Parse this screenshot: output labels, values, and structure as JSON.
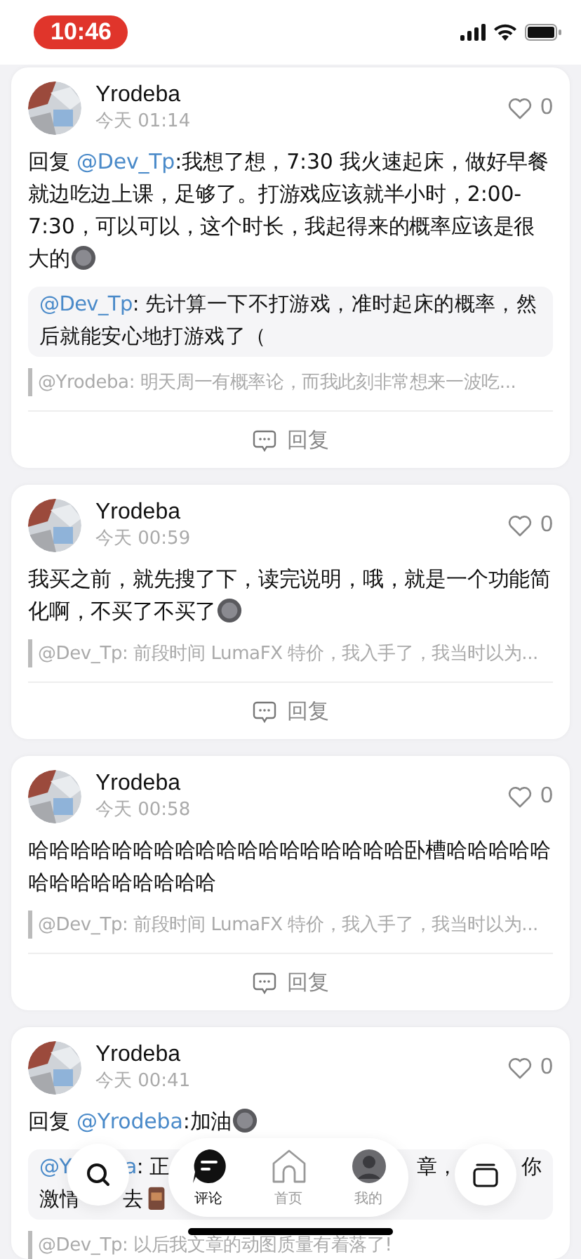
{
  "status_bar": {
    "time": "10:46"
  },
  "comments": [
    {
      "name": "Yrodeba",
      "time": "今天 01:14",
      "likes": "0",
      "liked": false,
      "body": [
        {
          "kind": "text",
          "text": "回复 "
        },
        {
          "kind": "mention",
          "text": "@Dev_Tp"
        },
        {
          "kind": "text",
          "text": ":我想了想，7:30 我火速起床，做好早餐就边吃边上课，足够了。打游戏应该就半小时，2:00-7:30，可以可以，这个时长，我起得来的概率应该是很大的"
        },
        {
          "kind": "sticker"
        }
      ],
      "quote": {
        "lines": [
          [
            [
              {
                "kind": "mention",
                "text": "@Dev_Tp"
              },
              {
                "kind": "text",
                "text": ": 先计算一下不打游戏，准时起床的概率，然"
              }
            ]
          ],
          [
            [
              {
                "kind": "text",
                "text": "后就能安心地打游戏了（"
              }
            ]
          ]
        ]
      },
      "cited": "@Yrodeba: 明天周一有概率论，而我此刻非常想来一波吃...",
      "reply": "回复"
    },
    {
      "name": "Yrodeba",
      "time": "今天 00:59",
      "likes": "0",
      "liked": false,
      "body": [
        {
          "kind": "text",
          "text": "我买之前，就先搜了下，读完说明，哦，就是一个功能简化啊，不买了不买了"
        },
        {
          "kind": "sticker"
        }
      ],
      "cited": "@Dev_Tp: 前段时间 LumaFX 特价，我入手了，我当时以为...",
      "reply": "回复"
    },
    {
      "name": "Yrodeba",
      "time": "今天 00:58",
      "likes": "0",
      "liked": false,
      "body": [
        {
          "kind": "text",
          "text": "哈哈哈哈哈哈哈哈哈哈哈哈哈哈哈哈哈哈卧槽哈哈哈哈哈哈哈哈哈哈哈哈哈哈"
        }
      ],
      "cited": "@Dev_Tp: 前段时间 LumaFX 特价，我入手了，我当时以为...",
      "reply": "回复"
    },
    {
      "name": "Yrodeba",
      "time": "今天 00:41",
      "likes": "0",
      "liked": false,
      "body": [
        {
          "kind": "text",
          "text": "回复 "
        },
        {
          "kind": "mention",
          "text": "@Yrodeba"
        },
        {
          "kind": "text",
          "text": ":加油"
        },
        {
          "kind": "sticker"
        }
      ],
      "quote": {
        "lines": [
          [
            [
              {
                "kind": "mention",
                "text": "@Y"
              }
            ],
            [
              {
                "kind": "mention",
                "text": "a"
              },
              {
                "kind": "text",
                "text": ": 正"
              }
            ],
            [
              {
                "kind": "text",
                "text": "章，"
              }
            ],
            [
              {
                "kind": "text",
                "text": "你"
              }
            ]
          ],
          [
            [
              {
                "kind": "text",
                "text": "激情"
              }
            ],
            [
              {
                "kind": "text",
                "text": "去"
              },
              {
                "kind": "sticker"
              }
            ]
          ]
        ]
      },
      "cited": "@Dev_Tp: 以后我文章的动图质量有着落了!"
    }
  ],
  "nav": {
    "items": [
      {
        "label": "评论",
        "selected": true
      },
      {
        "label": "首页",
        "selected": false
      },
      {
        "label": "我的",
        "selected": false
      }
    ]
  }
}
